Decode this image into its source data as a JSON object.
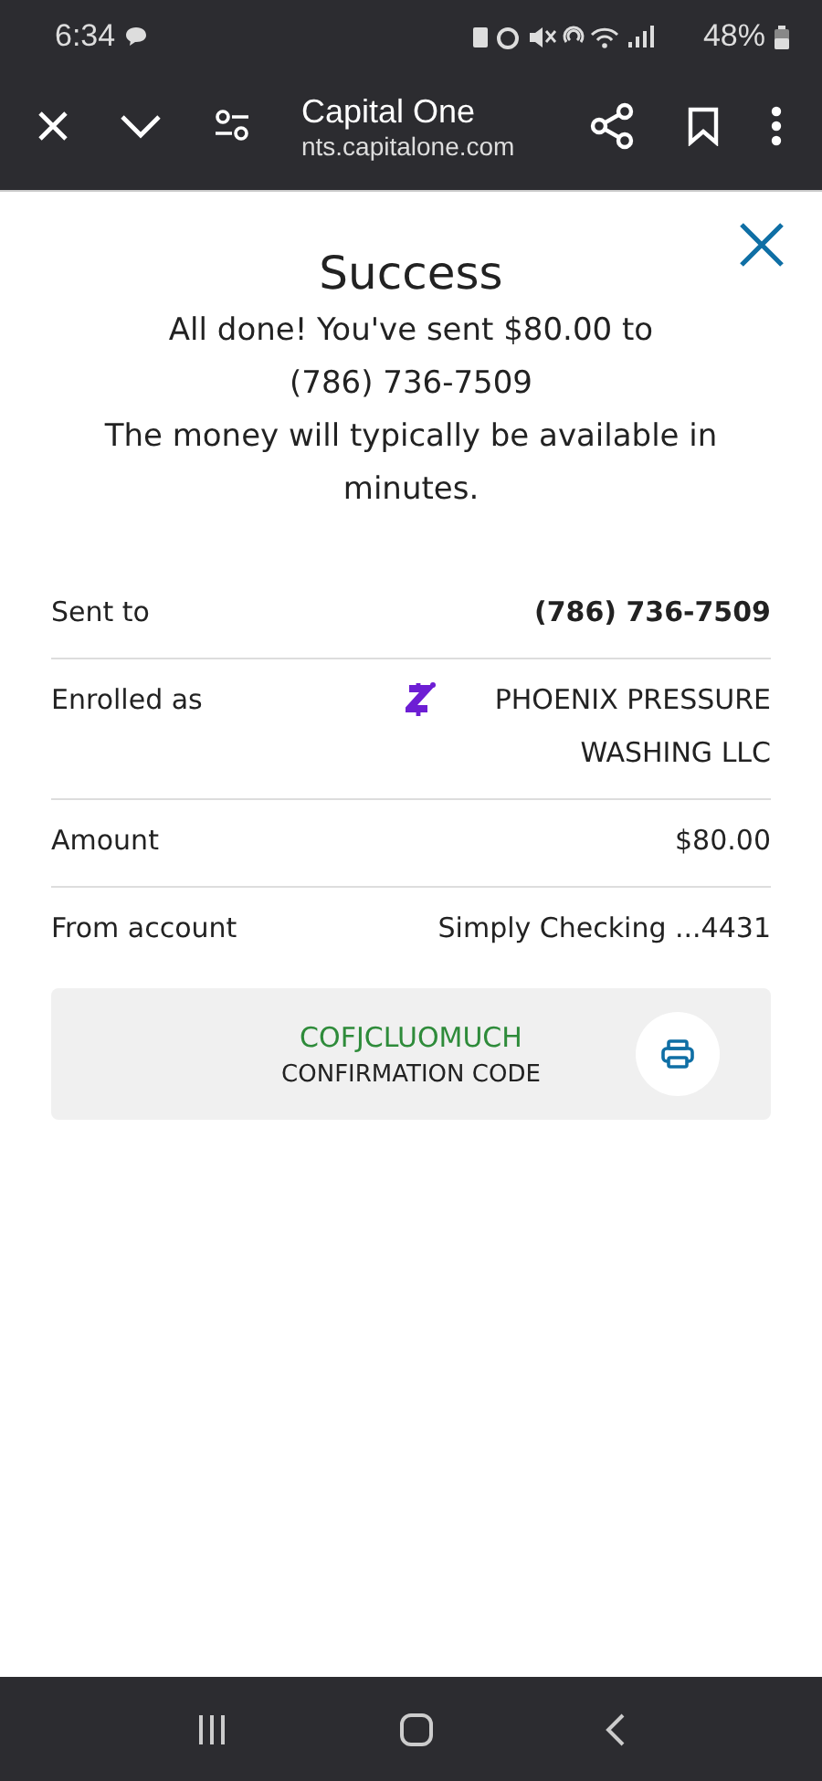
{
  "status_bar": {
    "time": "6:34",
    "battery": "48%"
  },
  "browser": {
    "title": "Capital One",
    "url": "nts.capitalone.com"
  },
  "success": {
    "title": "Success",
    "message_lines": [
      "All done! You've sent $80.00 to",
      "(786) 736-7509",
      "The money will typically be available in",
      "minutes."
    ]
  },
  "details": [
    {
      "kind": "bold",
      "label": "Sent to",
      "value": "(786) 736-7509"
    },
    {
      "kind": "zelle",
      "label": "Enrolled as",
      "value": "PHOENIX PRESSURE WASHING LLC"
    },
    {
      "kind": "plain",
      "label": "Amount",
      "value": "$80.00"
    },
    {
      "kind": "plain",
      "label": "From account",
      "value": "Simply Checking ...4431"
    }
  ],
  "confirmation": {
    "code": "COFJCLUOMUCH",
    "label": "CONFIRMATION CODE"
  }
}
